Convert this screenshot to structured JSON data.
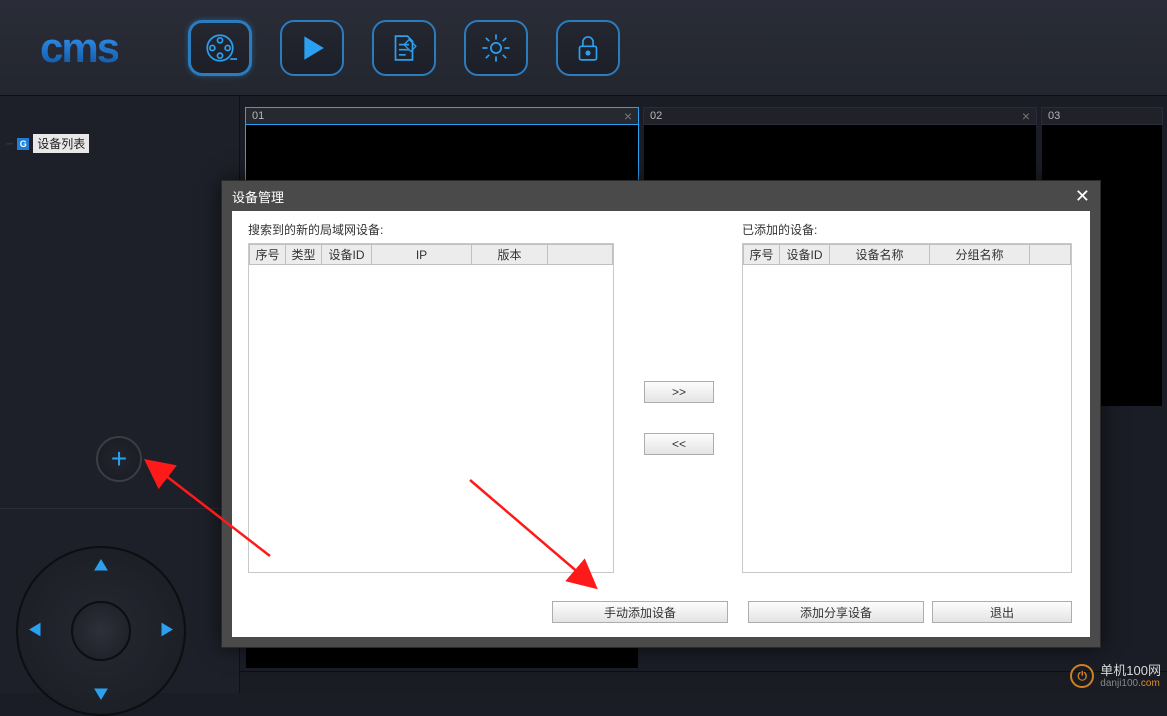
{
  "logo": "cms",
  "sidebar": {
    "root_label": "设备列表",
    "add_icon_glyph": "+"
  },
  "grid": {
    "cells": [
      {
        "id": "01",
        "selected": true
      },
      {
        "id": "02",
        "selected": false
      },
      {
        "id": "03",
        "selected": false
      }
    ]
  },
  "dialog": {
    "title": "设备管理",
    "left_group_label": "搜索到的新的局域网设备:",
    "right_group_label": "已添加的设备:",
    "left_columns": [
      "序号",
      "类型",
      "设备ID",
      "IP",
      "版本",
      ""
    ],
    "right_columns": [
      "序号",
      "设备ID",
      "设备名称",
      "分组名称",
      ""
    ],
    "move_right": ">>",
    "move_left": "<<",
    "buttons": {
      "manual_add": "手动添加设备",
      "add_share": "添加分享设备",
      "exit": "退出"
    },
    "close_glyph": "✕"
  },
  "watermark": {
    "line1": "单机100网",
    "line2_a": "danji100",
    "line2_b": ".com"
  }
}
